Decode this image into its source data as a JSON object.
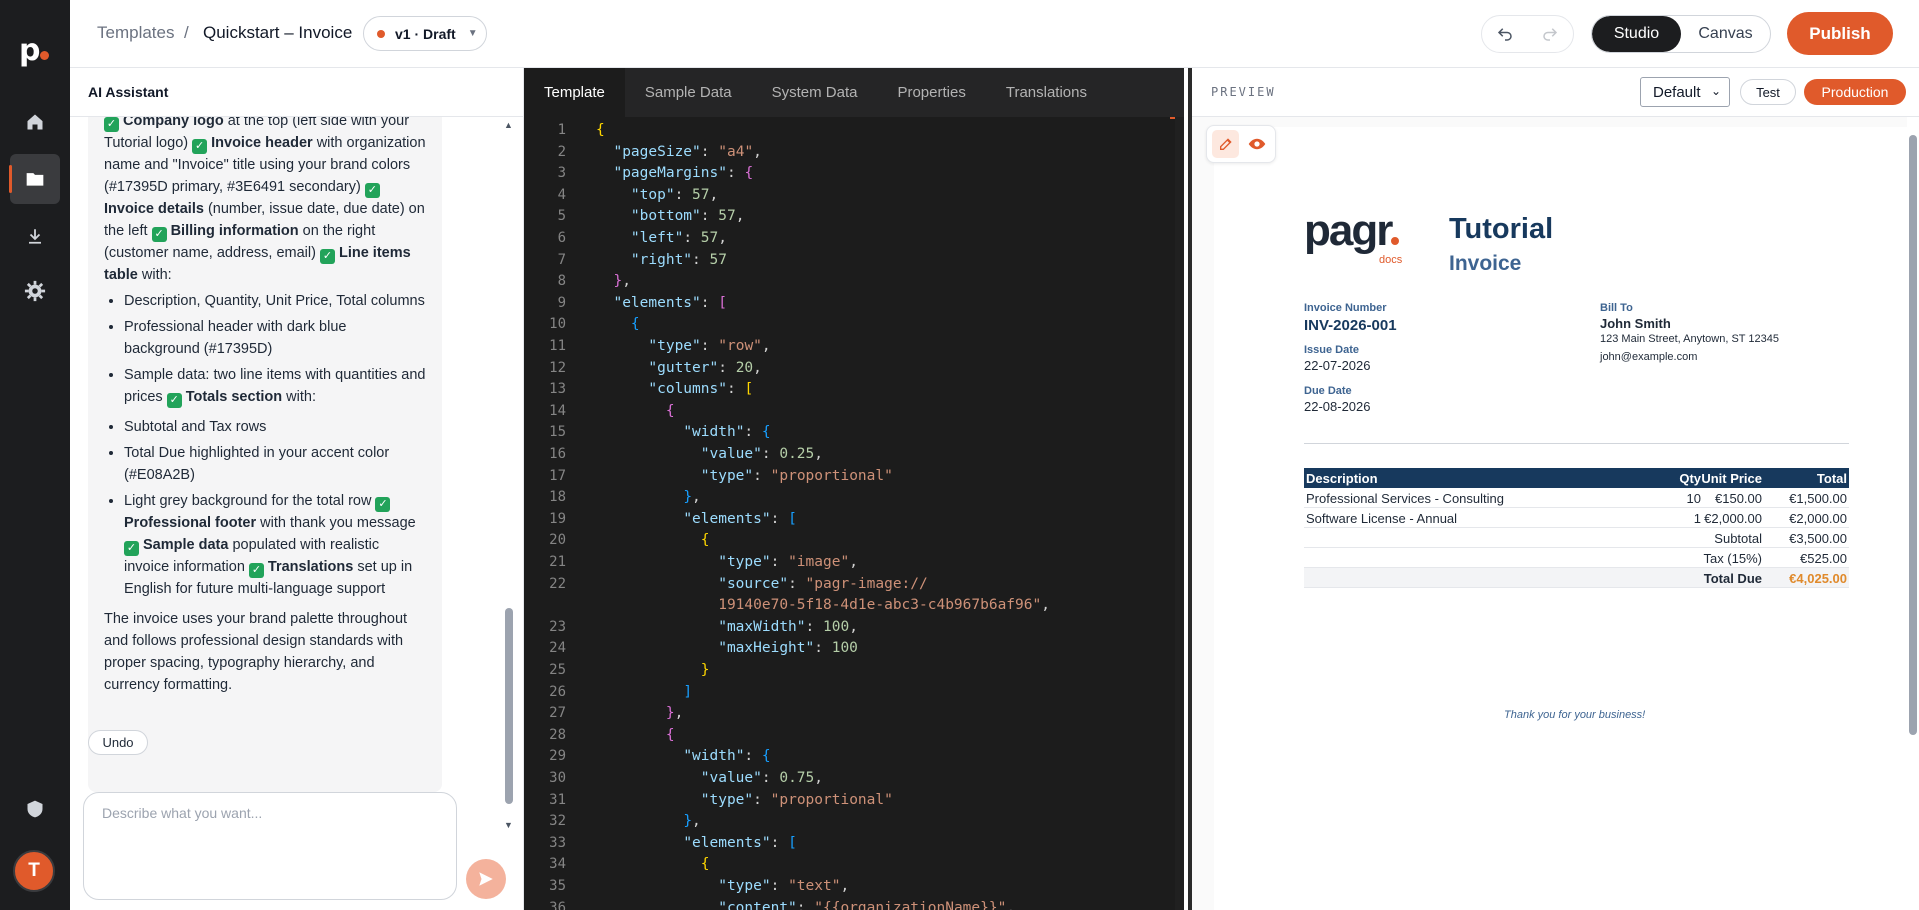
{
  "app": {
    "avatar_initial": "T",
    "accent_color": "#e05a2b"
  },
  "rail": {
    "items": [
      "home-icon",
      "folder-icon",
      "download-icon",
      "gear-icon",
      "shield-icon"
    ]
  },
  "header": {
    "breadcrumb_link": "Templates",
    "breadcrumb_sep": "/",
    "title": "Quickstart – Invoice",
    "version": "v1 · Draft",
    "mode_studio": "Studio",
    "mode_canvas": "Canvas",
    "publish": "Publish"
  },
  "assistant": {
    "title": "AI Assistant",
    "intro": [
      {
        "t": "check"
      },
      {
        "t": "b",
        "v": "Company logo"
      },
      {
        "t": "x",
        "v": " at the top (left side with your Tutorial logo) "
      },
      {
        "t": "check"
      },
      {
        "t": "b",
        "v": "Invoice header"
      },
      {
        "t": "x",
        "v": " with organization name and \"Invoice\" title using your brand colors (#17395D primary, #3E6491 secondary) "
      },
      {
        "t": "check"
      },
      {
        "t": "b",
        "v": "Invoice details"
      },
      {
        "t": "x",
        "v": " (number, issue date, due date) on the left "
      },
      {
        "t": "check"
      },
      {
        "t": "b",
        "v": "Billing information"
      },
      {
        "t": "x",
        "v": " on the right (customer name, address, email) "
      },
      {
        "t": "check"
      },
      {
        "t": "b",
        "v": "Line items table"
      },
      {
        "t": "x",
        "v": " with:"
      }
    ],
    "list1": [
      [
        {
          "t": "x",
          "v": "Description, Quantity, Unit Price, Total columns"
        }
      ],
      [
        {
          "t": "x",
          "v": "Professional header with dark blue background (#17395D)"
        }
      ],
      [
        {
          "t": "x",
          "v": "Sample data: two line items with quantities and prices "
        },
        {
          "t": "check"
        },
        {
          "t": "b",
          "v": "Totals section"
        },
        {
          "t": "x",
          "v": " with:"
        }
      ]
    ],
    "list2": [
      [
        {
          "t": "x",
          "v": "Subtotal and Tax rows"
        }
      ],
      [
        {
          "t": "x",
          "v": "Total Due highlighted in your accent color (#E08A2B)"
        }
      ],
      [
        {
          "t": "x",
          "v": "Light grey background for the total row "
        },
        {
          "t": "check"
        },
        {
          "t": "b",
          "v": "Professional footer"
        },
        {
          "t": "x",
          "v": " with thank you message "
        },
        {
          "t": "check"
        },
        {
          "t": "b",
          "v": "Sample data"
        },
        {
          "t": "x",
          "v": " populated with realistic invoice information "
        },
        {
          "t": "check"
        },
        {
          "t": "b",
          "v": "Translations"
        },
        {
          "t": "x",
          "v": " set up in English for future multi-language support"
        }
      ]
    ],
    "closing": "The invoice uses your brand palette throughout and follows professional design standards with proper spacing, typography hierarchy, and currency formatting.",
    "undo": "Undo",
    "input_placeholder": "Describe what you want..."
  },
  "editor": {
    "tabs": [
      "Template",
      "Sample Data",
      "System Data",
      "Properties",
      "Translations"
    ],
    "active_tab": "Template",
    "lines": [
      [
        [
          "b1",
          "{"
        ]
      ],
      [
        [
          "",
          "  "
        ],
        [
          "k",
          "\"pageSize\""
        ],
        [
          "",
          ": "
        ],
        [
          "s",
          "\"a4\""
        ],
        [
          "",
          ","
        ]
      ],
      [
        [
          "",
          "  "
        ],
        [
          "k",
          "\"pageMargins\""
        ],
        [
          "",
          ": "
        ],
        [
          "b2",
          "{"
        ]
      ],
      [
        [
          "",
          "    "
        ],
        [
          "k",
          "\"top\""
        ],
        [
          "",
          ": "
        ],
        [
          "n",
          "57"
        ],
        [
          "",
          ","
        ]
      ],
      [
        [
          "",
          "    "
        ],
        [
          "k",
          "\"bottom\""
        ],
        [
          "",
          ": "
        ],
        [
          "n",
          "57"
        ],
        [
          "",
          ","
        ]
      ],
      [
        [
          "",
          "    "
        ],
        [
          "k",
          "\"left\""
        ],
        [
          "",
          ": "
        ],
        [
          "n",
          "57"
        ],
        [
          "",
          ","
        ]
      ],
      [
        [
          "",
          "    "
        ],
        [
          "k",
          "\"right\""
        ],
        [
          "",
          ": "
        ],
        [
          "n",
          "57"
        ]
      ],
      [
        [
          "",
          "  "
        ],
        [
          "b2",
          "}"
        ],
        [
          "",
          ","
        ]
      ],
      [
        [
          "",
          "  "
        ],
        [
          "k",
          "\"elements\""
        ],
        [
          "",
          ": "
        ],
        [
          "b2",
          "["
        ]
      ],
      [
        [
          "",
          "    "
        ],
        [
          "b3",
          "{"
        ]
      ],
      [
        [
          "",
          "      "
        ],
        [
          "k",
          "\"type\""
        ],
        [
          "",
          ": "
        ],
        [
          "s",
          "\"row\""
        ],
        [
          "",
          ","
        ]
      ],
      [
        [
          "",
          "      "
        ],
        [
          "k",
          "\"gutter\""
        ],
        [
          "",
          ": "
        ],
        [
          "n",
          "20"
        ],
        [
          "",
          ","
        ]
      ],
      [
        [
          "",
          "      "
        ],
        [
          "k",
          "\"columns\""
        ],
        [
          "",
          ": "
        ],
        [
          "b1",
          "["
        ]
      ],
      [
        [
          "",
          "        "
        ],
        [
          "b2",
          "{"
        ]
      ],
      [
        [
          "",
          "          "
        ],
        [
          "k",
          "\"width\""
        ],
        [
          "",
          ": "
        ],
        [
          "b3",
          "{"
        ]
      ],
      [
        [
          "",
          "            "
        ],
        [
          "k",
          "\"value\""
        ],
        [
          "",
          ": "
        ],
        [
          "n",
          "0.25"
        ],
        [
          "",
          ","
        ]
      ],
      [
        [
          "",
          "            "
        ],
        [
          "k",
          "\"type\""
        ],
        [
          "",
          ": "
        ],
        [
          "s",
          "\"proportional\""
        ]
      ],
      [
        [
          "",
          "          "
        ],
        [
          "b3",
          "}"
        ],
        [
          "",
          ","
        ]
      ],
      [
        [
          "",
          "          "
        ],
        [
          "k",
          "\"elements\""
        ],
        [
          "",
          ": "
        ],
        [
          "b3",
          "["
        ]
      ],
      [
        [
          "",
          "            "
        ],
        [
          "b1",
          "{"
        ]
      ],
      [
        [
          "",
          "              "
        ],
        [
          "k",
          "\"type\""
        ],
        [
          "",
          ": "
        ],
        [
          "s",
          "\"image\""
        ],
        [
          "",
          ","
        ]
      ],
      [
        [
          "",
          "              "
        ],
        [
          "k",
          "\"source\""
        ],
        [
          "",
          ": "
        ],
        [
          "s",
          "\"pagr-image://"
        ]
      ],
      [
        [
          "",
          "              "
        ],
        [
          "s",
          "19140e70-5f18-4d1e-abc3-c4b967b6af96\""
        ],
        [
          "",
          ","
        ]
      ],
      [
        [
          "",
          "              "
        ],
        [
          "k",
          "\"maxWidth\""
        ],
        [
          "",
          ": "
        ],
        [
          "n",
          "100"
        ],
        [
          "",
          ","
        ]
      ],
      [
        [
          "",
          "              "
        ],
        [
          "k",
          "\"maxHeight\""
        ],
        [
          "",
          ": "
        ],
        [
          "n",
          "100"
        ]
      ],
      [
        [
          "",
          "            "
        ],
        [
          "b1",
          "}"
        ]
      ],
      [
        [
          "",
          "          "
        ],
        [
          "b3",
          "]"
        ]
      ],
      [
        [
          "",
          "        "
        ],
        [
          "b2",
          "}"
        ],
        [
          "",
          ","
        ]
      ],
      [
        [
          "",
          "        "
        ],
        [
          "b2",
          "{"
        ]
      ],
      [
        [
          "",
          "          "
        ],
        [
          "k",
          "\"width\""
        ],
        [
          "",
          ": "
        ],
        [
          "b3",
          "{"
        ]
      ],
      [
        [
          "",
          "            "
        ],
        [
          "k",
          "\"value\""
        ],
        [
          "",
          ": "
        ],
        [
          "n",
          "0.75"
        ],
        [
          "",
          ","
        ]
      ],
      [
        [
          "",
          "            "
        ],
        [
          "k",
          "\"type\""
        ],
        [
          "",
          ": "
        ],
        [
          "s",
          "\"proportional\""
        ]
      ],
      [
        [
          "",
          "          "
        ],
        [
          "b3",
          "}"
        ],
        [
          "",
          ","
        ]
      ],
      [
        [
          "",
          "          "
        ],
        [
          "k",
          "\"elements\""
        ],
        [
          "",
          ": "
        ],
        [
          "b3",
          "["
        ]
      ],
      [
        [
          "",
          "            "
        ],
        [
          "b1",
          "{"
        ]
      ],
      [
        [
          "",
          "              "
        ],
        [
          "k",
          "\"type\""
        ],
        [
          "",
          ": "
        ],
        [
          "s",
          "\"text\""
        ],
        [
          "",
          ","
        ]
      ],
      [
        [
          "",
          "              "
        ],
        [
          "k",
          "\"content\""
        ],
        [
          "",
          ": "
        ],
        [
          "s",
          "\"{{organizationName}}\""
        ],
        [
          "",
          ","
        ]
      ]
    ],
    "line_numbers": [
      "1",
      "2",
      "3",
      "4",
      "5",
      "6",
      "7",
      "8",
      "9",
      "10",
      "11",
      "12",
      "13",
      "14",
      "15",
      "16",
      "17",
      "18",
      "19",
      "20",
      "21",
      "22",
      "",
      "23",
      "24",
      "25",
      "26",
      "27",
      "28",
      "29",
      "30",
      "31",
      "32",
      "33",
      "34",
      "35",
      "36"
    ]
  },
  "preview": {
    "label": "PREVIEW",
    "environment": "Default",
    "test": "Test",
    "production": "Production"
  },
  "invoice": {
    "logo_text": "pagr",
    "logo_sub": "docs",
    "org_name": "Tutorial",
    "title": "Invoice",
    "number_label": "Invoice Number",
    "number": "INV-2026-001",
    "issue_label": "Issue Date",
    "issue_date": "22-07-2026",
    "due_label": "Due Date",
    "due_date": "22-08-2026",
    "bill_label": "Bill To",
    "customer_name": "John Smith",
    "customer_address": "123 Main Street, Anytown, ST 12345",
    "customer_email": "john@example.com",
    "table": {
      "headers": [
        "Description",
        "Qty",
        "Unit Price",
        "Total"
      ],
      "rows": [
        [
          "Professional Services - Consulting",
          "10",
          "€150.00",
          "€1,500.00"
        ],
        [
          "Software License - Annual",
          "1",
          "€2,000.00",
          "€2,000.00"
        ]
      ],
      "subtotal_label": "Subtotal",
      "subtotal": "€3,500.00",
      "tax_label": "Tax (15%)",
      "tax": "€525.00",
      "due_label": "Total Due",
      "due": "€4,025.00",
      "primary_color": "#17395d",
      "secondary_color": "#3e6491",
      "accent_color": "#e08a2b"
    },
    "thanks": "Thank you for your business!"
  }
}
